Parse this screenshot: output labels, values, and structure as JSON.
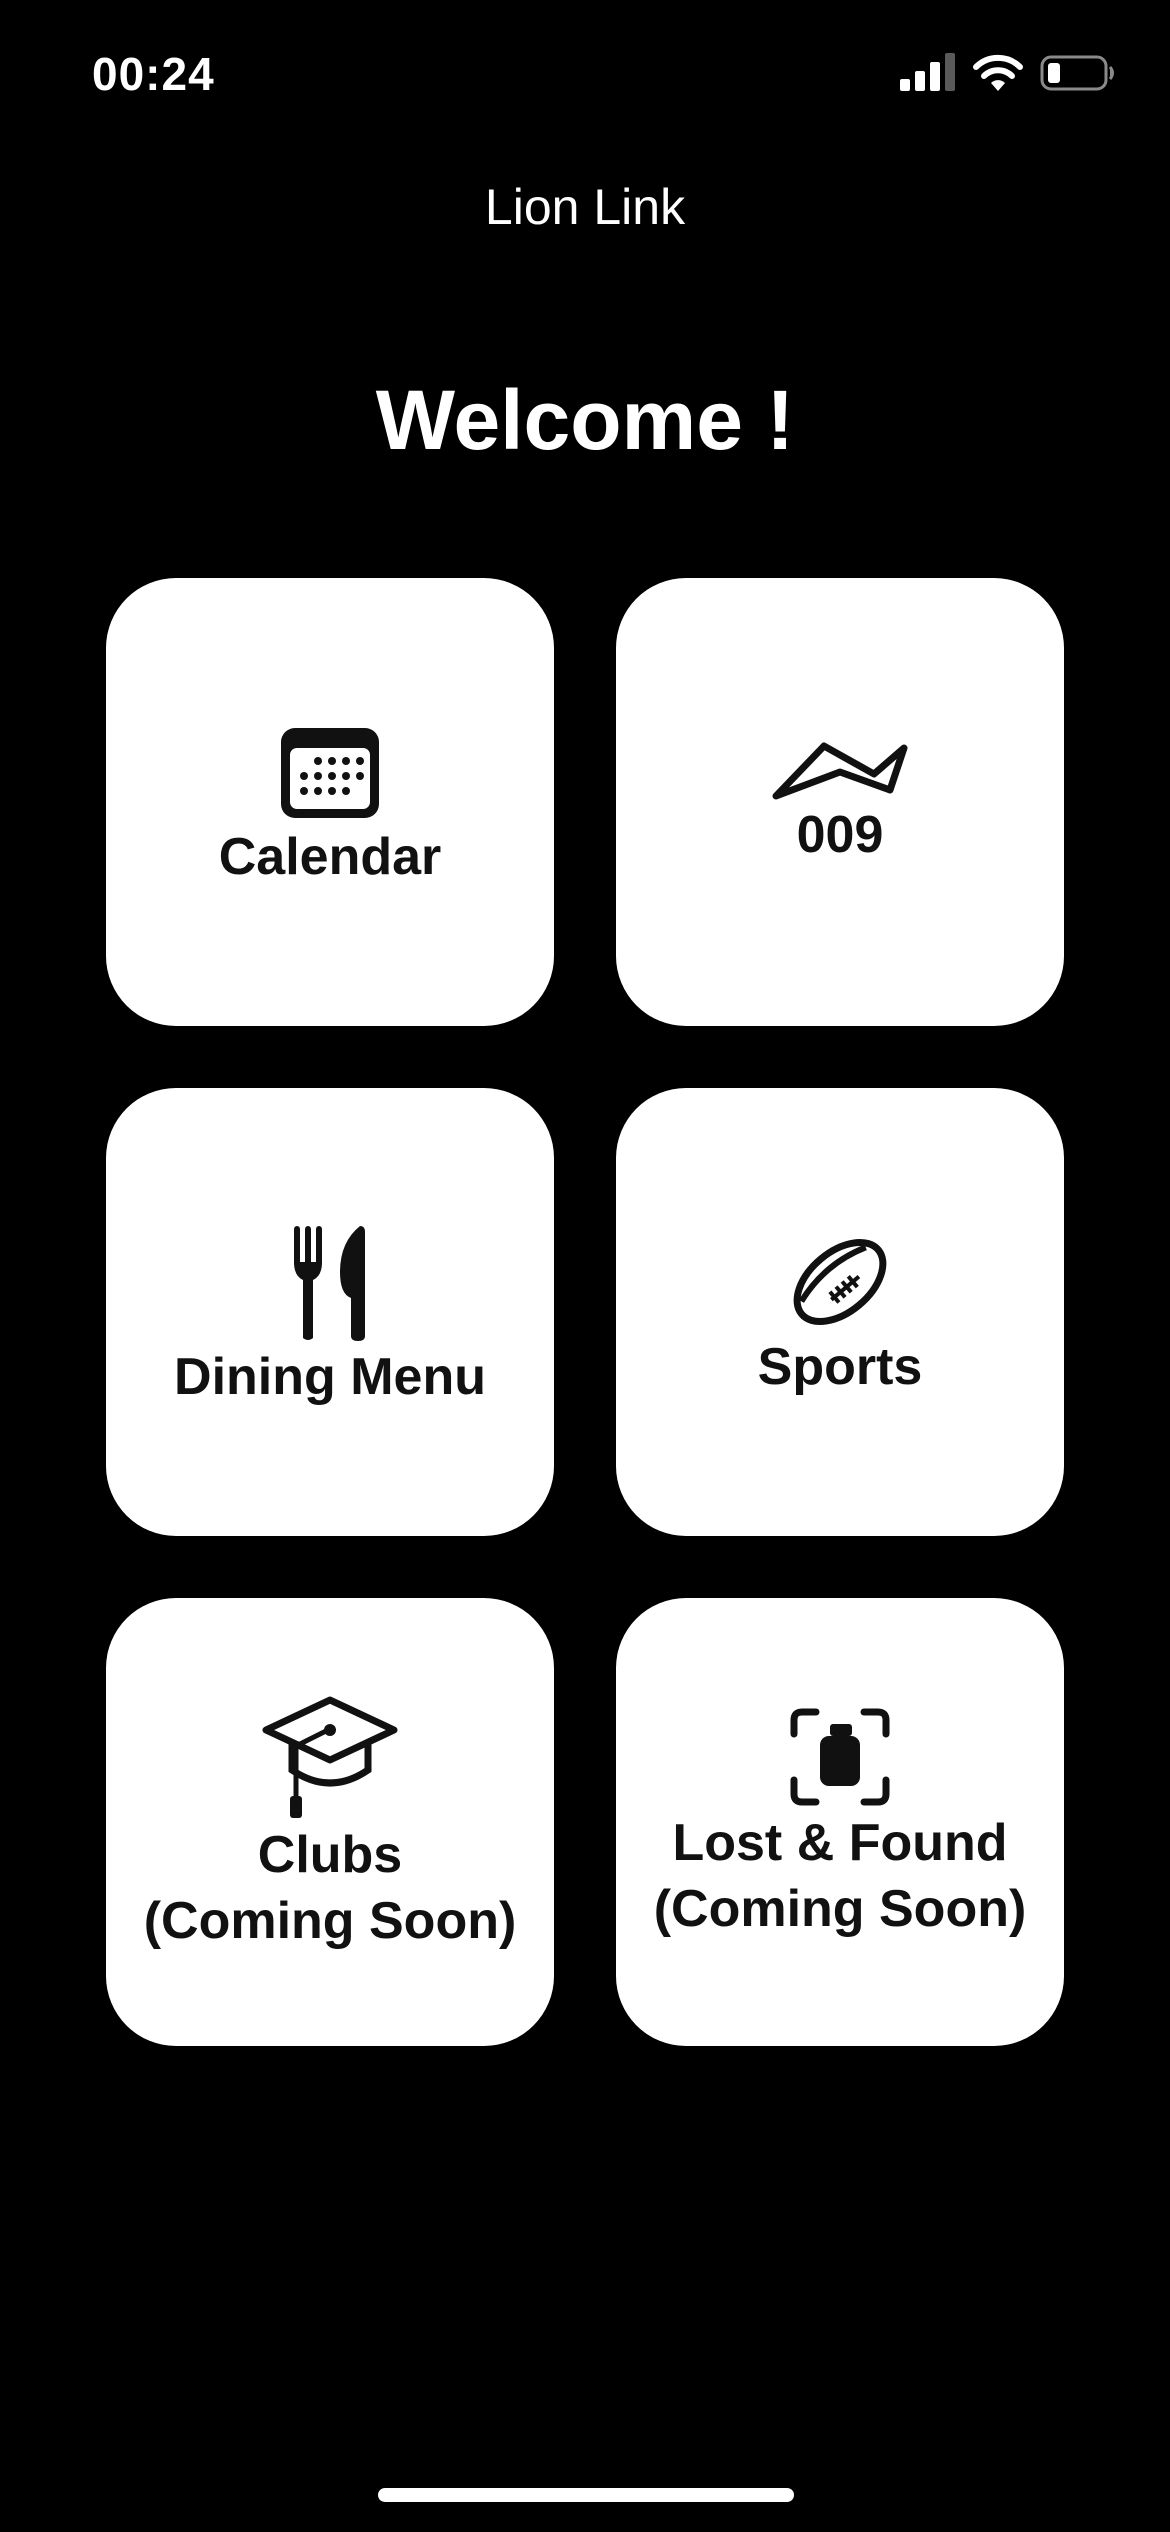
{
  "status_bar": {
    "time": "00:24",
    "icons": [
      "cellular-signal-icon",
      "wifi-icon",
      "battery-icon"
    ]
  },
  "nav": {
    "title": "Lion Link"
  },
  "main": {
    "welcome": "Welcome !",
    "tiles": [
      {
        "label": "Calendar",
        "icon": "calendar-icon"
      },
      {
        "label": "009",
        "icon": "wave-icon"
      },
      {
        "label": "Dining Menu",
        "icon": "fork-knife-icon"
      },
      {
        "label": "Sports",
        "icon": "football-icon"
      },
      {
        "label_line1": "Clubs",
        "label_line2": "(Coming Soon)",
        "icon": "graduation-cap-icon"
      },
      {
        "label_line1": "Lost & Found",
        "label_line2": "(Coming Soon)",
        "icon": "object-scan-icon"
      }
    ]
  },
  "colors": {
    "background": "#000000",
    "tile": "#ffffff",
    "tile_text": "#111111",
    "text": "#ffffff"
  }
}
